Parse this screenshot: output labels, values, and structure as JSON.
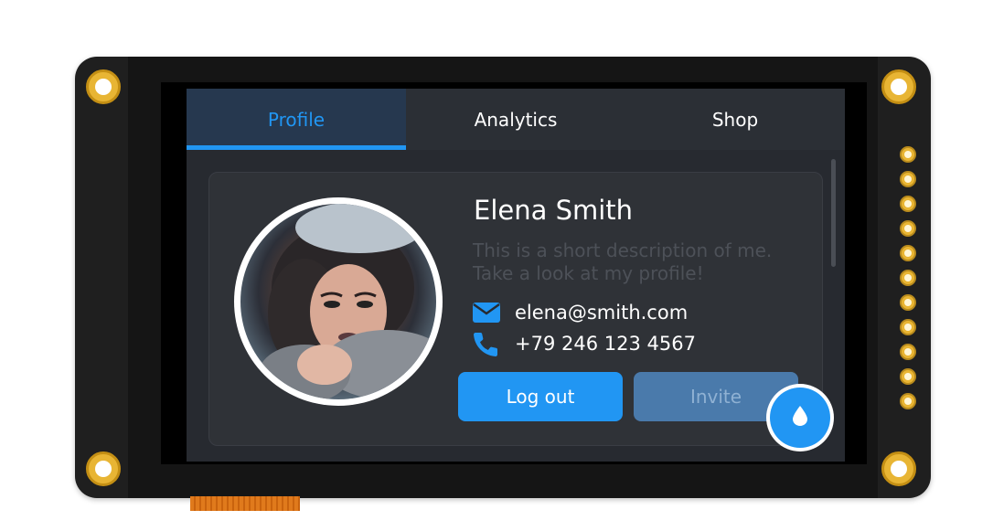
{
  "tabs": [
    {
      "label": "Profile",
      "active": true
    },
    {
      "label": "Analytics",
      "active": false
    },
    {
      "label": "Shop",
      "active": false
    }
  ],
  "profile": {
    "name": "Elena Smith",
    "description": "This is a short description of me.\n Take a look at my profile!",
    "email": "elena@smith.com",
    "phone": "+79 246 123 4567",
    "email_icon": "envelope-icon",
    "phone_icon": "phone-icon"
  },
  "buttons": {
    "logout_label": "Log out",
    "invite_label": "Invite"
  },
  "fab": {
    "icon": "water-drop-icon"
  },
  "colors": {
    "accent": "#2196f3",
    "screen_bg": "#272a30",
    "card_bg": "#2f3237",
    "tab_active_bg": "#26384f",
    "secondary_button": "#4a7aab",
    "board_pad": "#e8b534"
  }
}
